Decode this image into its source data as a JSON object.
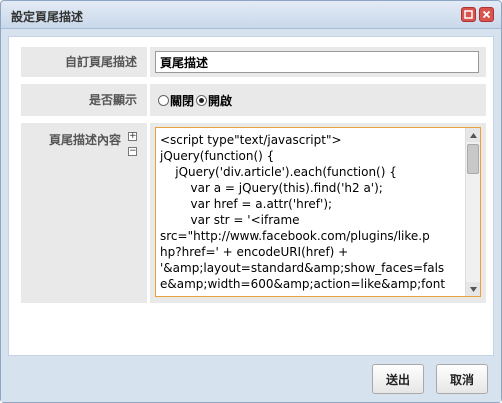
{
  "dialog": {
    "title": "設定頁尾描述"
  },
  "form": {
    "custom_label": "自訂頁尾描述",
    "custom_value": "頁尾描述",
    "display_label": "是否顯示",
    "display_options": [
      {
        "label": "關閉",
        "checked": false
      },
      {
        "label": "開啟",
        "checked": true
      }
    ],
    "content_label": "頁尾描述內容",
    "expand_symbol": "+",
    "collapse_symbol": "−",
    "content_lines": [
      "<script type\"text/javascript\">",
      "jQuery(function() {",
      "    jQuery('div.article').each(function() {",
      "        var a = jQuery(this).find('h2 a');",
      "        var href = a.attr('href');",
      "        var str = '<iframe",
      "src=\"http://www.facebook.com/plugins/like.p",
      "hp?href=' + encodeURI(href) +",
      "'&amp;layout=standard&amp;show_faces=fals",
      "e&amp;width=600&amp;action=like&amp;font"
    ]
  },
  "footer": {
    "submit_label": "送出",
    "cancel_label": "取消"
  },
  "colors": {
    "frame": "#d7e2ef",
    "row_bg": "#e9e9e9",
    "focus_border": "#e8a13c",
    "close_red": "#d9534f"
  }
}
